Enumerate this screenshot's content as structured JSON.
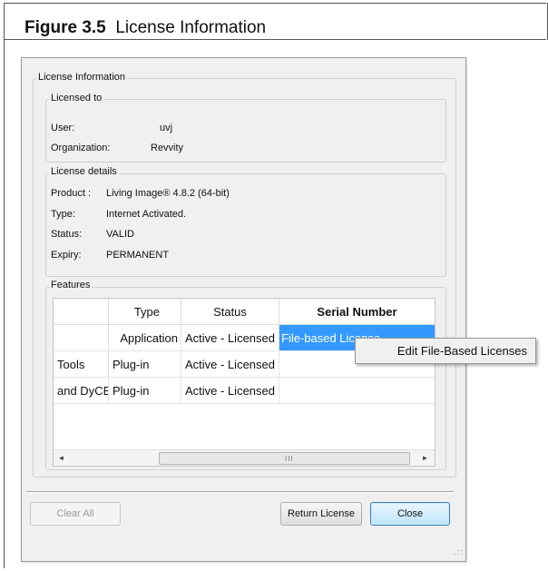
{
  "figure": {
    "number": "Figure 3.5",
    "caption": "License Information"
  },
  "dialog": {
    "group_title": "License Information",
    "licensed_to": {
      "legend": "Licensed to",
      "user_label": "User:",
      "user_value": "uvj",
      "org_label": "Organization:",
      "org_value": "Revvity"
    },
    "license_details": {
      "legend": "License details",
      "product_label": "Product :",
      "product_value": "Living Image® 4.8.2 (64-bit)",
      "type_label": "Type:",
      "type_value": "Internet Activated.",
      "status_label": "Status:",
      "status_value": "VALID",
      "expiry_label": "Expiry:",
      "expiry_value": "PERMANENT"
    },
    "features": {
      "legend": "Features",
      "columns": [
        "",
        "Type",
        "Status",
        "Serial Number"
      ],
      "rows": [
        {
          "name": "",
          "type": "Application",
          "status": "Active - Licensed",
          "serial": "File-based License"
        },
        {
          "name": "Tools",
          "type": "Plug-in",
          "status": "Active - Licensed",
          "serial": ""
        },
        {
          "name": "and DyCE",
          "type": "Plug-in",
          "status": "Active - Licensed",
          "serial": ""
        }
      ],
      "scroll_left_icon": "◄",
      "scroll_right_icon": "►",
      "scroll_grip": "III"
    },
    "context_menu": {
      "item": "Edit File-Based Licenses"
    },
    "buttons": {
      "clear_all": "Clear All",
      "return_license": "Return License",
      "close": "Close"
    },
    "resize_grip": ".::"
  }
}
